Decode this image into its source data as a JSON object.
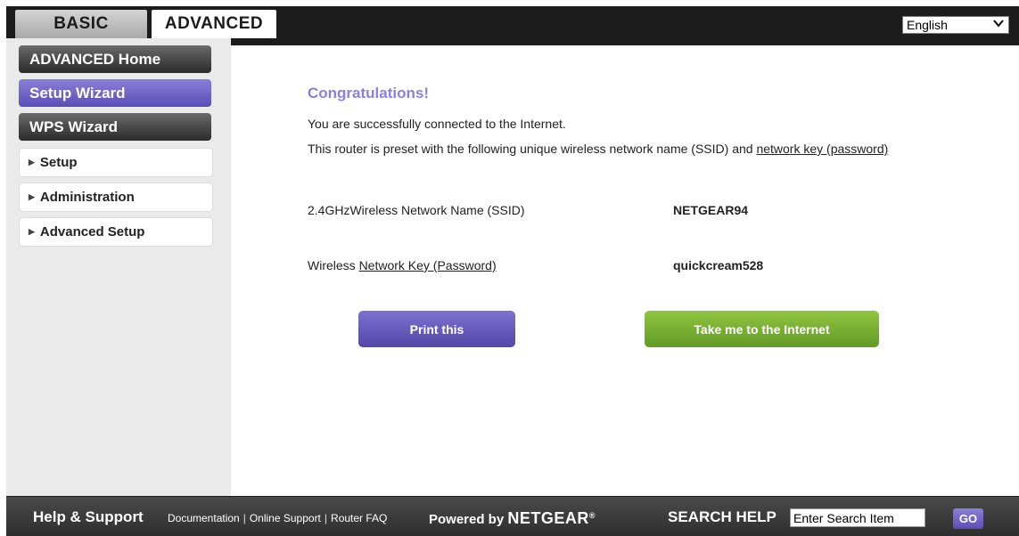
{
  "tabs": {
    "basic": "BASIC",
    "advanced": "ADVANCED"
  },
  "language": {
    "selected": "English",
    "chevron": "chevron-down-icon"
  },
  "sidebar": {
    "items": [
      {
        "label": "ADVANCED Home"
      },
      {
        "label": "Setup Wizard"
      },
      {
        "label": "WPS Wizard"
      },
      {
        "label": "Setup"
      },
      {
        "label": "Administration"
      },
      {
        "label": "Advanced Setup"
      }
    ],
    "arrow_glyph": "▶"
  },
  "main": {
    "title": "Congratulations!",
    "message1": "You are successfully connected to the Internet.",
    "message2_prefix": "This router is preset with the following unique wireless network name (SSID) and ",
    "message2_link": "network key (password)",
    "ssid_label": "2.4GHzWireless Network Name (SSID)",
    "ssid_value": "NETGEAR94",
    "key_label_prefix": "Wireless ",
    "key_label_link": "Network Key (Password)",
    "key_value": "quickcream528",
    "print_button": "Print this",
    "internet_button": "Take me to the Internet"
  },
  "footer": {
    "help_title": "Help & Support",
    "links": [
      "Documentation",
      "Online Support",
      "Router FAQ"
    ],
    "link_separator": "|",
    "powered_prefix": "Powered by ",
    "powered_brand": "NETGEAR",
    "registered": "®",
    "search_label": "SEARCH HELP",
    "search_value": "Enter Search Item",
    "go_button": "GO"
  },
  "colors": {
    "accent_purple": "#5a4db7",
    "congrats_purple": "#8b7fe6",
    "green": "#639a26",
    "frame_dark": "#1c1c1c"
  }
}
